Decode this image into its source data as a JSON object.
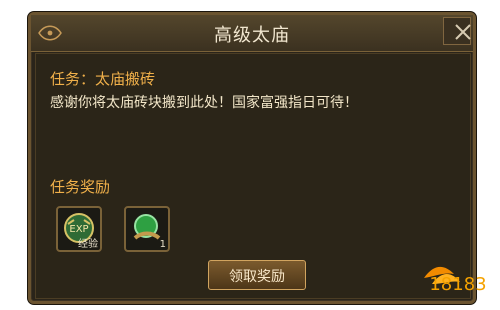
{
  "dialog": {
    "title": "高级太庙",
    "task_line": "任务：太庙搬砖",
    "description": "感谢你将太庙砖块搬到此处！国家富强指日可待！",
    "reward_header": "任务奖励",
    "rewards": [
      {
        "icon": "exp-icon",
        "label": "经验"
      },
      {
        "icon": "jade-orb-icon",
        "label": "1"
      }
    ],
    "claim_label": "领取奖励"
  },
  "watermark": {
    "text": "18183",
    "icon": "bird-logo-icon"
  }
}
